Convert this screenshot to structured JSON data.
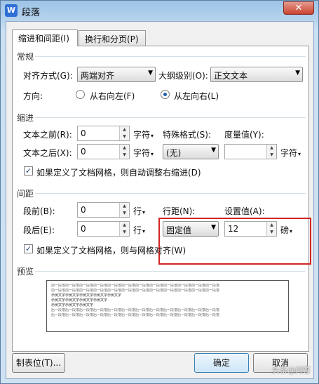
{
  "window": {
    "title": "段落",
    "app_icon": "W",
    "close_label": "✕"
  },
  "tabs": [
    {
      "label": "缩进和间距(I)"
    },
    {
      "label": "换行和分页(P)"
    }
  ],
  "general": {
    "section_label": "常规",
    "alignment_label": "对齐方式(G):",
    "alignment_value": "两端对齐",
    "outline_label": "大纲级别(O):",
    "outline_value": "正文文本",
    "direction_label": "方向:",
    "rtl_label": "从右向左(F)",
    "ltr_label": "从左向右(L)"
  },
  "indent": {
    "section_label": "缩进",
    "before_label": "文本之前(R):",
    "before_value": "0",
    "before_unit": "字符",
    "special_label": "特殊格式(S):",
    "special_value": "(无)",
    "measure_label": "度量值(Y):",
    "measure_value": "",
    "measure_unit": "字符",
    "after_label": "文本之后(X):",
    "after_value": "0",
    "after_unit": "字符",
    "grid_check_label": "如果定义了文档网格，则自动调整右缩进(D)"
  },
  "spacing": {
    "section_label": "间距",
    "before_label": "段前(B):",
    "before_value": "0",
    "before_unit": "行",
    "after_label": "段后(E):",
    "after_value": "0",
    "after_unit": "行",
    "line_label": "行距(N):",
    "line_value": "固定值",
    "setting_label": "设置值(A):",
    "setting_value": "12",
    "setting_unit": "磅",
    "grid_check_label": "如果定义了文档网格，则与网格对齐(W)"
  },
  "preview": {
    "section_label": "预览",
    "prev_line": "前一段落前一段落前一段落前一段落前一段落前一段落前一段落前一段落前一段落前一段落前一段落前一段落",
    "sample1": "示例文字示例文字示例文字示例文字示例文字",
    "sample2": "示例文字示例文字示例文字示例文字",
    "sample3": "示例文字示例文字示例文字",
    "next_line": "后一段落后一段落后一段落后一段落后一段落后一段落后一段落后一段落后一段落后一段落后一段落后一段落"
  },
  "footer": {
    "tabs_button": "制表位(T)...",
    "ok_button": "确定",
    "cancel_button": "取消",
    "watermark": "头条@问答"
  }
}
